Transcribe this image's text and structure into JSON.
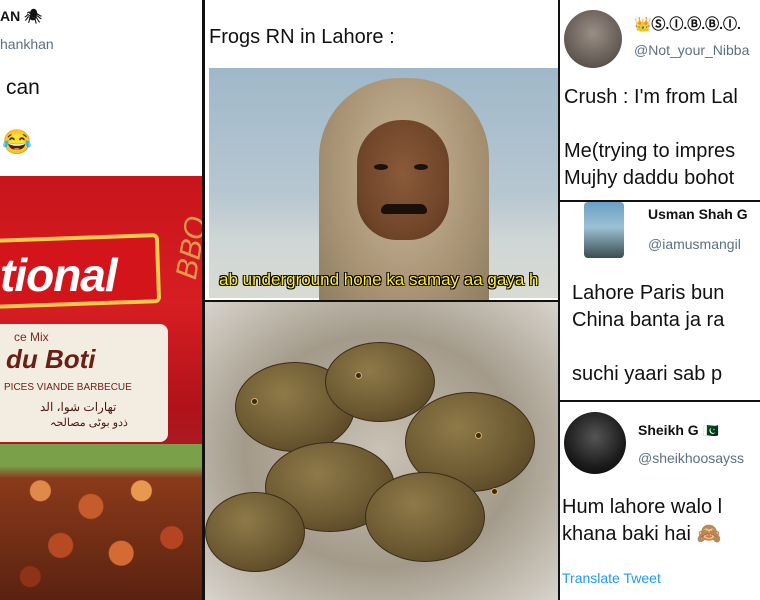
{
  "colors": {
    "link": "#1d9bf0",
    "handle": "#5b7083",
    "caption": "#ffeb3b"
  },
  "left": {
    "author_name": "AN 🕷",
    "handle": "hankhan",
    "text": "can",
    "emoji": "😂",
    "packet": {
      "brand": "tional",
      "mix": "ce Mix",
      "product": "du Boti",
      "french": "PICES VIANDE BARBECUE",
      "urdu_line1": "تهارات شوا، الد",
      "urdu_line2": "ذدو بوٹی مصالحہ",
      "side": "BBQ"
    }
  },
  "middle_top": {
    "title": "Frogs RN in Lahore :",
    "caption": "ab underground hone ka samay aa gaya h",
    "image_icon": "man-in-shawl-photo"
  },
  "middle_bottom": {
    "image_icon": "frogs-in-sack-photo"
  },
  "right": {
    "tweet1": {
      "name": "👑Ⓢ.Ⓘ.Ⓑ.Ⓑ.Ⓘ.",
      "handle": "@Not_your_Nibba",
      "text": "Crush : I'm from Lal\n\nMe(trying to impres\nMujhy daddu bohot"
    },
    "tweet2": {
      "name": "Usman Shah G",
      "handle": "@iamusmangil",
      "text": "Lahore Paris bun\nChina banta ja ra\n\nsuchi yaari sab p"
    },
    "tweet3": {
      "name": "Sheikh G",
      "flag": "🇵🇰",
      "handle": "@sheikhoosayss",
      "text": "Hum lahore walo l\nkhana baki hai 🙈",
      "translate": "Translate Tweet"
    }
  }
}
